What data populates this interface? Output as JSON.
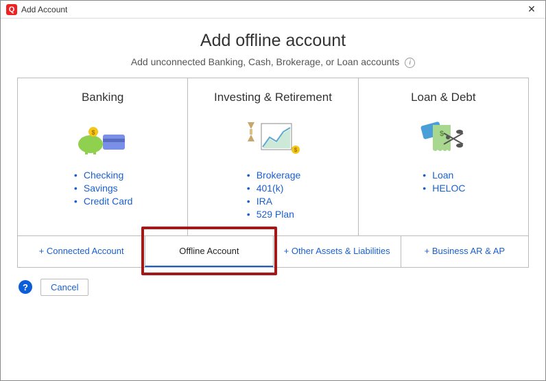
{
  "window": {
    "title": "Add Account",
    "app_icon_letter": "Q"
  },
  "header": {
    "main": "Add offline account",
    "sub": "Add unconnected Banking, Cash, Brokerage, or Loan accounts",
    "info_symbol": "i"
  },
  "categories": [
    {
      "title": "Banking",
      "links": [
        "Checking",
        "Savings",
        "Credit Card"
      ]
    },
    {
      "title": "Investing & Retirement",
      "links": [
        "Brokerage",
        "401(k)",
        "IRA",
        "529 Plan"
      ]
    },
    {
      "title": "Loan & Debt",
      "links": [
        "Loan",
        "HELOC"
      ]
    }
  ],
  "tabs": [
    {
      "label": "+ Connected Account",
      "active": false
    },
    {
      "label": "Offline Account",
      "active": true
    },
    {
      "label": "+ Other Assets & Liabilities",
      "active": false
    },
    {
      "label": "+ Business AR & AP",
      "active": false
    }
  ],
  "footer": {
    "help_symbol": "?",
    "cancel_label": "Cancel"
  }
}
